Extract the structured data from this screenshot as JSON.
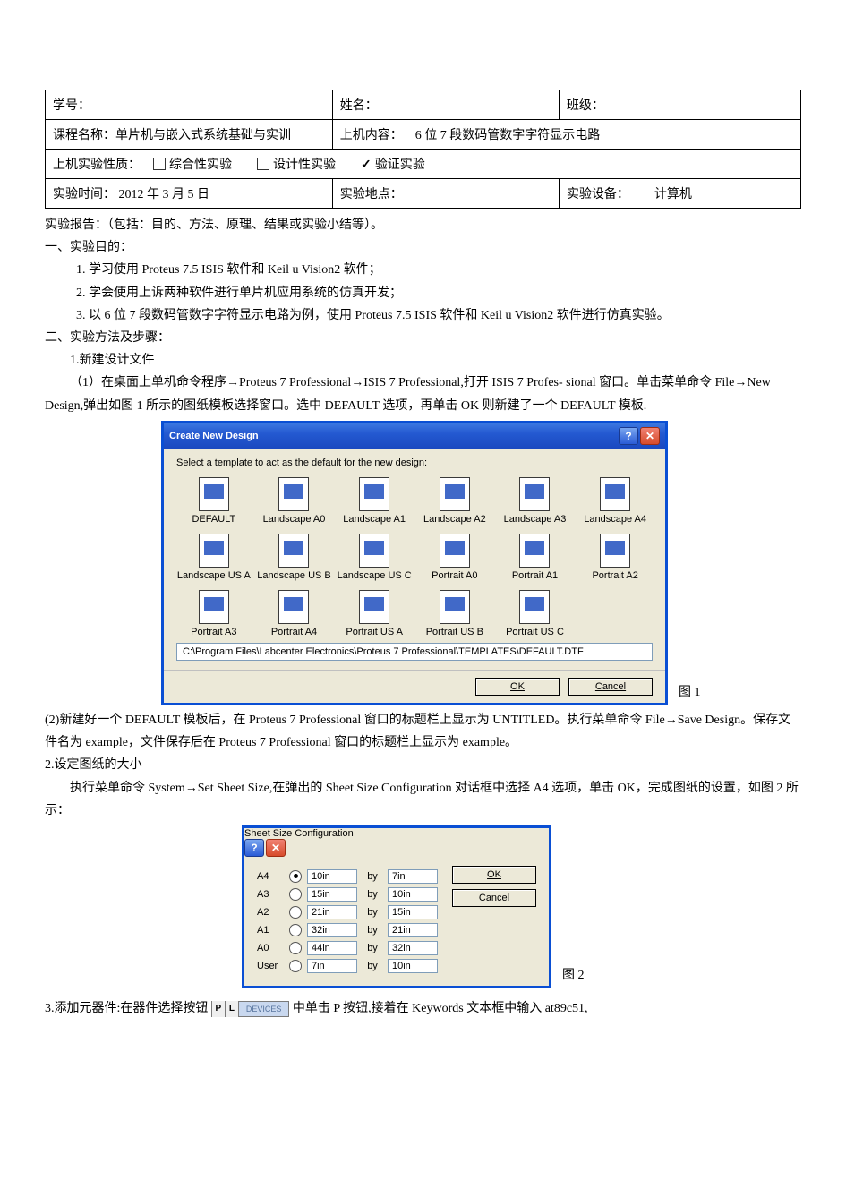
{
  "header_table": {
    "student_id_label": "学号：",
    "name_label": "姓名：",
    "class_label": "班级：",
    "course_label": "课程名称：单片机与嵌入式系统基础与实训",
    "machine_content_label": "上机内容：",
    "machine_content_value": "6 位 7 段数码管数字字符显示电路",
    "exp_nature_label": "上机实验性质：",
    "exp_opt1": "综合性实验",
    "exp_opt2": "设计性实验",
    "exp_opt3": "验证实验",
    "exp_time_label": "实验时间：",
    "exp_time_value": "2012 年 3 月 5 日",
    "exp_place_label": "实验地点：",
    "exp_device_label": "实验设备：",
    "exp_device_value": "计算机"
  },
  "body": {
    "report_intro": "实验报告：（包括：目的、方法、原理、结果或实验小结等）。",
    "sec1_title": "一、实验目的：",
    "sec1_item1": "1. 学习使用 Proteus  7.5  ISIS 软件和 Keil u Vision2 软件；",
    "sec1_item2": "2. 学会使用上诉两种软件进行单片机应用系统的仿真开发；",
    "sec1_item3": "3. 以 6 位 7 段数码管数字字符显示电路为例，使用 Proteus  7.5  ISIS 软件和 Keil u Vision2 软件进行仿真实验。",
    "sec2_title": "二、实验方法及步骤：",
    "sec2_sub1": "1.新建设计文件",
    "para1": "（1）在桌面上单机命令程序→Proteus 7 Professional→ISIS 7 Professional,打开 ISIS 7 Profes- sional 窗口。单击菜单命令 File→New Design,弹出如图 1 所示的图纸模板选择窗口。选中 DEFAULT 选项，再单击 OK 则新建了一个 DEFAULT 模板.",
    "fig1_label": "图 1",
    "para2": "(2)新建好一个 DEFAULT 模板后，在 Proteus 7 Professional 窗口的标题栏上显示为 UNTITLED。执行菜单命令 File→Save Design。保存文件名为 example，文件保存后在 Proteus 7 Professional 窗口的标题栏上显示为 example。",
    "sec2_sub2": "2.设定图纸的大小",
    "para3": "执行菜单命令 System→Set Sheet Size,在弹出的 Sheet Size Configuration 对话框中选择 A4 选项，单击 OK，完成图纸的设置，如图 2 所示：",
    "fig2_label": "图 2",
    "para4_a": "3.添加元器件:在器件选择按钮",
    "para4_b": "中单击 P 按钮,接着在 Keywords 文本框中输入 at89c51,"
  },
  "dialog1": {
    "title": "Create New Design",
    "prompt": "Select a template to act as the default for the new design:",
    "templates_row1": [
      "DEFAULT",
      "Landscape A0",
      "Landscape A1",
      "Landscape A2",
      "Landscape A3",
      "Landscape A4"
    ],
    "templates_row2": [
      "Landscape US A",
      "Landscape US B",
      "Landscape US C",
      "Portrait A0",
      "Portrait A1",
      "Portrait A2"
    ],
    "templates_row3": [
      "Portrait A3",
      "Portrait A4",
      "Portrait US A",
      "Portrait US B",
      "Portrait US C"
    ],
    "path": "C:\\Program Files\\Labcenter Electronics\\Proteus 7 Professional\\TEMPLATES\\DEFAULT.DTF",
    "ok": "OK",
    "cancel": "Cancel"
  },
  "dialog2": {
    "title": "Sheet Size Configuration",
    "rows": [
      {
        "name": "A4",
        "selected": true,
        "w": "10in",
        "h": "7in"
      },
      {
        "name": "A3",
        "selected": false,
        "w": "15in",
        "h": "10in"
      },
      {
        "name": "A2",
        "selected": false,
        "w": "21in",
        "h": "15in"
      },
      {
        "name": "A1",
        "selected": false,
        "w": "32in",
        "h": "21in"
      },
      {
        "name": "A0",
        "selected": false,
        "w": "44in",
        "h": "32in"
      },
      {
        "name": "User",
        "selected": false,
        "w": "7in",
        "h": "10in"
      }
    ],
    "by": "by",
    "ok": "OK",
    "cancel": "Cancel"
  },
  "pl_badge": {
    "p": "P",
    "l": "L",
    "devices": "DEVICES"
  }
}
